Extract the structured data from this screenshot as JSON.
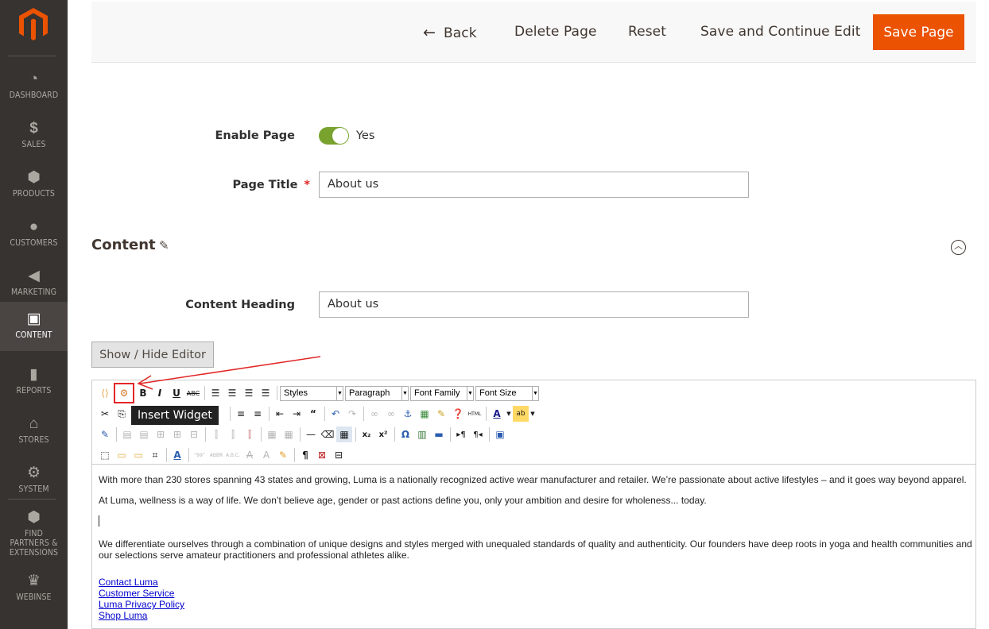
{
  "sidebar": {
    "items": [
      {
        "label": "DASHBOARD",
        "icon": "dashboard-icon"
      },
      {
        "label": "SALES",
        "icon": "dollar-icon"
      },
      {
        "label": "PRODUCTS",
        "icon": "cube-icon"
      },
      {
        "label": "CUSTOMERS",
        "icon": "person-icon"
      },
      {
        "label": "MARKETING",
        "icon": "megaphone-icon"
      },
      {
        "label": "CONTENT",
        "icon": "layout-icon"
      },
      {
        "label": "REPORTS",
        "icon": "bar-chart-icon"
      },
      {
        "label": "STORES",
        "icon": "store-icon"
      },
      {
        "label": "SYSTEM",
        "icon": "gear-icon"
      },
      {
        "label": "FIND PARTNERS & EXTENSIONS",
        "icon": "boxes-icon"
      },
      {
        "label": "WEBINSE",
        "icon": "crown-icon"
      }
    ],
    "active": "CONTENT",
    "brand_color": "#eb5202"
  },
  "actions": {
    "back": "Back",
    "delete": "Delete Page",
    "reset": "Reset",
    "save_continue": "Save and Continue Edit",
    "save": "Save Page"
  },
  "form": {
    "enable_label": "Enable Page",
    "enable_value": "Yes",
    "enable_on": true,
    "title_label": "Page Title",
    "title_value": "About us",
    "section_title": "Content",
    "heading_label": "Content Heading",
    "heading_value": "About us",
    "show_hide": "Show / Hide Editor"
  },
  "editor": {
    "selects": {
      "styles": "Styles",
      "paragraph": "Paragraph",
      "font_family": "Font Family",
      "font_size": "Font Size"
    },
    "tooltip": "Insert Widget",
    "paragraphs": [
      "With more than 230 stores spanning 43 states and growing, Luma is a nationally recognized active wear manufacturer and retailer. We’re passionate about active lifestyles – and it goes way beyond apparel.",
      "At Luma, wellness is a way of life. We don’t believe age, gender or past actions define you, only your ambition and desire for wholeness... today.",
      "We differentiate ourselves through a combination of unique designs and styles merged with unequaled standards of quality and authenticity. Our founders have deep roots in yoga and health communities and our selections serve amateur practitioners and professional athletes alike."
    ],
    "links": [
      "Contact Luma",
      "Customer Service",
      "Luma Privacy Policy",
      "Shop Luma"
    ]
  },
  "colors": {
    "accent": "#eb5202",
    "toggle": "#79a22e",
    "annotation": "#e22626"
  }
}
